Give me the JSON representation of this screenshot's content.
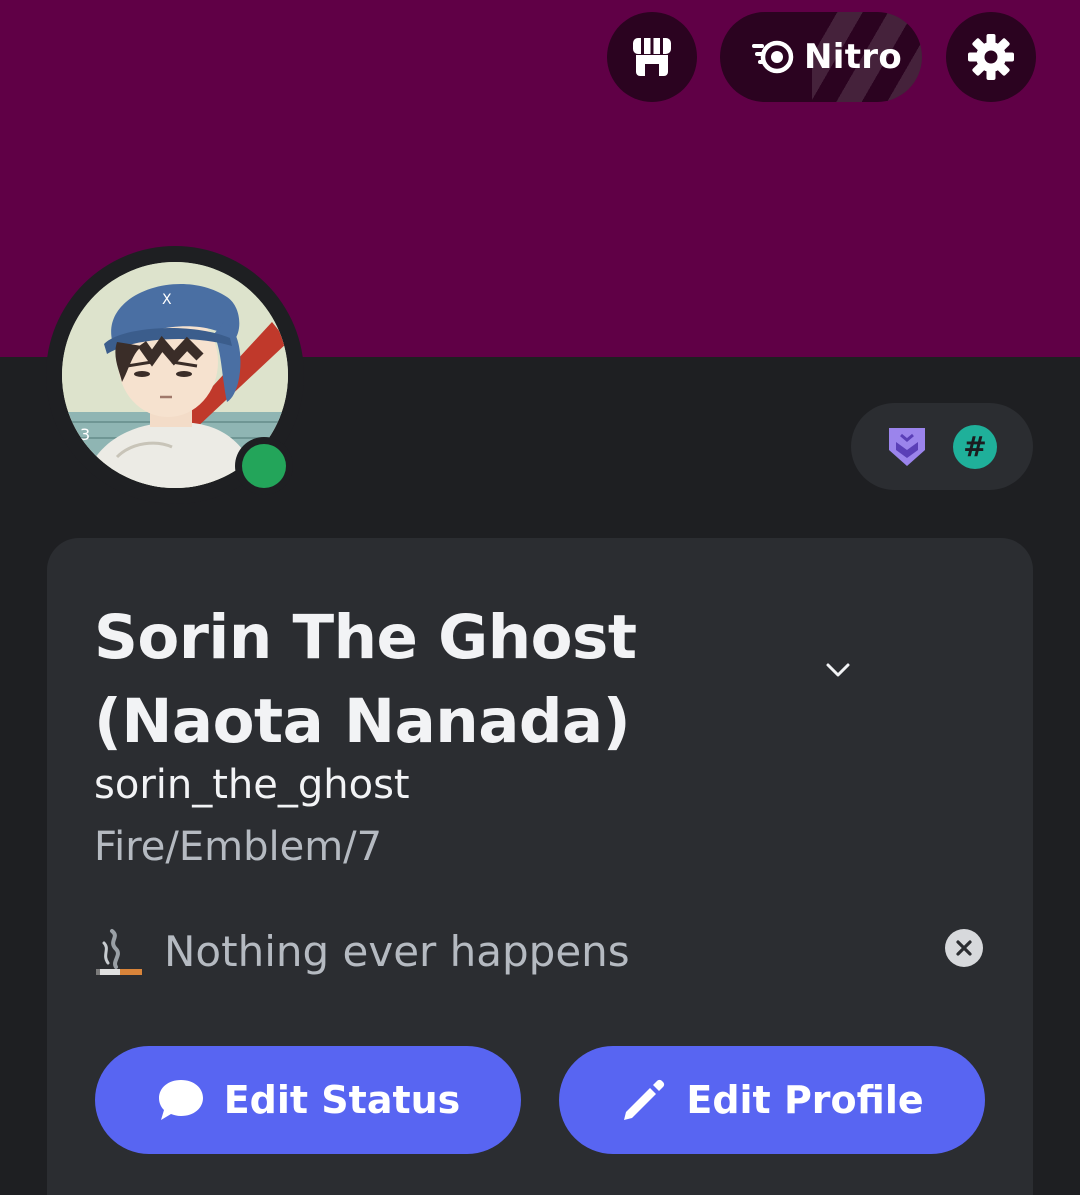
{
  "header": {
    "shop_icon": "shop-icon",
    "nitro_label": "Nitro",
    "settings_icon": "gear-icon"
  },
  "colors": {
    "banner": "#600046",
    "background": "#1e1f22",
    "card": "#2b2d31",
    "accent": "#5865f2",
    "online": "#23a55a"
  },
  "profile": {
    "status": "online",
    "badges": [
      "hypesquad-icon",
      "hash-icon"
    ],
    "badge_hash_text": "#",
    "display_name": "Sorin The Ghost (Naota Nanada)",
    "username": "sorin_the_ghost",
    "pronouns": "Fire/Emblem/7"
  },
  "custom_status": {
    "emoji": "cigarette-icon",
    "text": "Nothing ever happens"
  },
  "actions": {
    "edit_status_label": "Edit Status",
    "edit_profile_label": "Edit Profile"
  }
}
